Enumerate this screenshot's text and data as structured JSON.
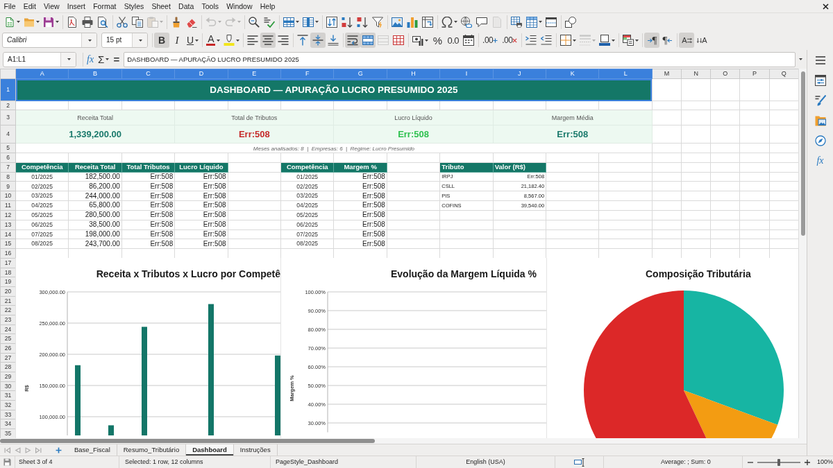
{
  "menu_bar": [
    "File",
    "Edit",
    "View",
    "Insert",
    "Format",
    "Styles",
    "Sheet",
    "Data",
    "Tools",
    "Window",
    "Help"
  ],
  "standard_toolbar": [
    [
      {
        "kind": "split",
        "disabled": false
      },
      {
        "kind": "split",
        "disabled": false
      },
      {
        "kind": "split",
        "disabled": false
      }
    ],
    [
      {
        "kind": "button",
        "disabled": false
      },
      {
        "kind": "button",
        "disabled": false
      },
      {
        "kind": "button",
        "disabled": false
      }
    ],
    [
      {
        "kind": "button",
        "disabled": false
      },
      {
        "kind": "button",
        "disabled": false
      },
      {
        "kind": "split",
        "disabled": true
      }
    ],
    [
      {
        "kind": "button",
        "disabled": false
      },
      {
        "kind": "button",
        "disabled": false
      }
    ],
    [
      {
        "kind": "split",
        "disabled": true
      },
      {
        "kind": "split",
        "disabled": true
      }
    ],
    [
      {
        "kind": "button",
        "disabled": false
      },
      {
        "kind": "button",
        "disabled": false
      }
    ],
    [
      {
        "kind": "split",
        "disabled": false
      },
      {
        "kind": "split",
        "disabled": false
      }
    ],
    [
      {
        "kind": "button",
        "disabled": false
      },
      {
        "kind": "button",
        "disabled": false
      },
      {
        "kind": "button",
        "disabled": false
      },
      {
        "kind": "button",
        "disabled": false
      }
    ],
    [
      {
        "kind": "button",
        "disabled": false
      },
      {
        "kind": "button",
        "disabled": false
      },
      {
        "kind": "button",
        "disabled": false
      }
    ],
    [
      {
        "kind": "split",
        "disabled": false
      },
      {
        "kind": "button",
        "disabled": false
      },
      {
        "kind": "button",
        "disabled": false
      },
      {
        "kind": "button",
        "disabled": true
      }
    ],
    [
      {
        "kind": "button",
        "disabled": false
      },
      {
        "kind": "split",
        "disabled": false
      },
      {
        "kind": "button",
        "disabled": false
      }
    ],
    [
      {
        "kind": "button",
        "disabled": false
      }
    ]
  ],
  "formatting_toolbar": {
    "font_name": "Calibri",
    "font_size": "15 pt",
    "groups": [
      [
        {
          "kind": "button",
          "label": "B",
          "pressed": true,
          "disabled": false
        },
        {
          "kind": "button",
          "label": "I",
          "pressed": false,
          "disabled": false
        },
        {
          "kind": "split",
          "label": "U",
          "pressed": false,
          "disabled": false
        }
      ],
      [
        {
          "kind": "split",
          "label": "A",
          "pressed": false,
          "disabled": false
        },
        {
          "kind": "split",
          "pressed": false,
          "disabled": false
        }
      ],
      [
        {
          "kind": "button",
          "pressed": false,
          "disabled": false
        },
        {
          "kind": "button",
          "pressed": true,
          "disabled": false
        },
        {
          "kind": "button",
          "pressed": false,
          "disabled": false
        }
      ],
      [
        {
          "kind": "button",
          "pressed": false,
          "disabled": false
        },
        {
          "kind": "button",
          "pressed": true,
          "disabled": false
        },
        {
          "kind": "button",
          "pressed": false,
          "disabled": false
        }
      ],
      [
        {
          "kind": "button",
          "pressed": true,
          "disabled": false
        },
        {
          "kind": "button",
          "pressed": true,
          "disabled": false
        },
        {
          "kind": "button",
          "pressed": false,
          "disabled": true
        },
        {
          "kind": "button",
          "pressed": false,
          "disabled": false
        }
      ],
      [
        {
          "kind": "split",
          "pressed": false,
          "disabled": false
        },
        {
          "kind": "button",
          "label": "%",
          "pressed": false,
          "disabled": false
        },
        {
          "kind": "button",
          "label": "0.0",
          "pressed": false,
          "disabled": false
        },
        {
          "kind": "button",
          "pressed": false,
          "disabled": false
        }
      ],
      [
        {
          "kind": "button",
          "label": ".00",
          "pressed": false,
          "disabled": false
        },
        {
          "kind": "button",
          "label": ".00",
          "pressed": false,
          "disabled": false
        }
      ],
      [
        {
          "kind": "button",
          "pressed": false,
          "disabled": false
        },
        {
          "kind": "button",
          "pressed": false,
          "disabled": false
        }
      ],
      [
        {
          "kind": "split",
          "pressed": false,
          "disabled": false
        },
        {
          "kind": "split",
          "pressed": false,
          "disabled": true
        },
        {
          "kind": "split",
          "pressed": false,
          "disabled": false
        }
      ],
      [
        {
          "kind": "split",
          "pressed": false,
          "disabled": false
        }
      ],
      [
        {
          "kind": "button",
          "label": "¶",
          "pressed": true,
          "disabled": false
        },
        {
          "kind": "button",
          "label": "¶",
          "pressed": false,
          "disabled": false
        }
      ],
      [
        {
          "kind": "button",
          "label": "A",
          "pressed": true,
          "disabled": false
        },
        {
          "kind": "button",
          "label": "A",
          "pressed": false,
          "disabled": false
        }
      ]
    ]
  },
  "formula_bar": {
    "name_box": "A1:L1",
    "function_wizard": "fx",
    "sum": "Σ",
    "equals": "=",
    "formula": "DASHBOARD — APURAÇÃO LUCRO PRESUMIDO 2025"
  },
  "sidebar": [
    {
      "kind": "icon"
    },
    {
      "kind": "icon"
    },
    {
      "kind": "icon"
    },
    {
      "kind": "icon"
    },
    {
      "kind": "icon"
    },
    {
      "kind": "text",
      "label": "fx"
    }
  ],
  "sheet": {
    "columns": [
      {
        "label": "A",
        "selected": true
      },
      {
        "label": "B",
        "selected": true
      },
      {
        "label": "C",
        "selected": true
      },
      {
        "label": "D",
        "selected": true
      },
      {
        "label": "E",
        "selected": true
      },
      {
        "label": "F",
        "selected": true
      },
      {
        "label": "G",
        "selected": true
      },
      {
        "label": "H",
        "selected": true
      },
      {
        "label": "I",
        "selected": true
      },
      {
        "label": "J",
        "selected": true
      },
      {
        "label": "K",
        "selected": true
      },
      {
        "label": "L",
        "selected": true
      },
      {
        "label": "M",
        "selected": false
      },
      {
        "label": "N",
        "selected": false
      },
      {
        "label": "O",
        "selected": false
      },
      {
        "label": "P",
        "selected": false
      },
      {
        "label": "Q",
        "selected": false
      }
    ],
    "rows": [
      {
        "label": "1",
        "selected": true
      },
      {
        "label": "2",
        "selected": false
      },
      {
        "label": "3",
        "selected": false
      },
      {
        "label": "4",
        "selected": false
      },
      {
        "label": "5",
        "selected": false
      },
      {
        "label": "6",
        "selected": false
      },
      {
        "label": "7",
        "selected": false
      },
      {
        "label": "8",
        "selected": false
      },
      {
        "label": "9",
        "selected": false
      },
      {
        "label": "10",
        "selected": false
      },
      {
        "label": "11",
        "selected": false
      },
      {
        "label": "12",
        "selected": false
      },
      {
        "label": "13",
        "selected": false
      },
      {
        "label": "14",
        "selected": false
      },
      {
        "label": "15",
        "selected": false
      },
      {
        "label": "16",
        "selected": false
      },
      {
        "label": "17",
        "selected": false
      },
      {
        "label": "18",
        "selected": false
      },
      {
        "label": "19",
        "selected": false
      },
      {
        "label": "20",
        "selected": false
      },
      {
        "label": "21",
        "selected": false
      },
      {
        "label": "22",
        "selected": false
      },
      {
        "label": "23",
        "selected": false
      },
      {
        "label": "24",
        "selected": false
      },
      {
        "label": "25",
        "selected": false
      },
      {
        "label": "26",
        "selected": false
      },
      {
        "label": "27",
        "selected": false
      },
      {
        "label": "28",
        "selected": false
      },
      {
        "label": "29",
        "selected": false
      },
      {
        "label": "30",
        "selected": false
      },
      {
        "label": "31",
        "selected": false
      },
      {
        "label": "32",
        "selected": false
      },
      {
        "label": "33",
        "selected": false
      },
      {
        "label": "34",
        "selected": false
      },
      {
        "label": "35",
        "selected": false
      }
    ],
    "title": {
      "text": "DASHBOARD — APURAÇÃO LUCRO PRESUMIDO 2025",
      "selected": true
    },
    "kpis": [
      {
        "label": "Receita Total",
        "value": "1,339,200.00",
        "color": "#1b7a6c"
      },
      {
        "label": "Total de Tributos",
        "value": "Err:508",
        "color": "#c62b2b"
      },
      {
        "label": "Lucro Líquido",
        "value": "Err:508",
        "color": "#2fc150"
      },
      {
        "label": "Margem Média",
        "value": "Err:508",
        "color": "#1b7a6c"
      }
    ],
    "note": "Meses analisados: 8  |  Empresas: 6  |  Regime: Lucro Presumido",
    "tables": [
      {
        "columns": [
          "Competência",
          "Receita Total",
          "Total Tributos",
          "Lucro Líquido"
        ],
        "rows": [
          [
            "01/2025",
            "182,500.00",
            "Err:508",
            "Err:508"
          ],
          [
            "02/2025",
            "86,200.00",
            "Err:508",
            "Err:508"
          ],
          [
            "03/2025",
            "244,000.00",
            "Err:508",
            "Err:508"
          ],
          [
            "04/2025",
            "65,800.00",
            "Err:508",
            "Err:508"
          ],
          [
            "05/2025",
            "280,500.00",
            "Err:508",
            "Err:508"
          ],
          [
            "06/2025",
            "38,500.00",
            "Err:508",
            "Err:508"
          ],
          [
            "07/2025",
            "198,000.00",
            "Err:508",
            "Err:508"
          ],
          [
            "08/2025",
            "243,700.00",
            "Err:508",
            "Err:508"
          ]
        ]
      },
      {
        "columns": [
          "Competência",
          "Margem %"
        ],
        "rows": [
          [
            "01/2025",
            "Err:508"
          ],
          [
            "02/2025",
            "Err:508"
          ],
          [
            "03/2025",
            "Err:508"
          ],
          [
            "04/2025",
            "Err:508"
          ],
          [
            "05/2025",
            "Err:508"
          ],
          [
            "06/2025",
            "Err:508"
          ],
          [
            "07/2025",
            "Err:508"
          ],
          [
            "08/2025",
            "Err:508"
          ]
        ]
      },
      {
        "columns": [
          "Tributo",
          "Valor (R$)"
        ],
        "rows": [
          [
            "IRPJ",
            "Err:508"
          ],
          [
            "CSLL",
            "21,182.40"
          ],
          [
            "PIS",
            "8,567.00"
          ],
          [
            "COFINS",
            "39,540.00"
          ]
        ]
      }
    ],
    "charts": [
      {
        "chart_data": {
          "type": "bar",
          "title": "Receita x Tributos x Lucro por Competê",
          "ylabel": "R$",
          "categories": [
            null,
            null,
            null,
            null,
            null,
            null,
            null
          ],
          "ylim": [
            70000,
            300000
          ],
          "grid": true,
          "yticks": [
            {
              "value": 100000,
              "label": "100,000.00"
            },
            {
              "value": 150000,
              "label": "150,000.00"
            },
            {
              "value": 200000,
              "label": "200,000.00"
            },
            {
              "value": 250000,
              "label": "250,000.00"
            },
            {
              "value": 300000,
              "label": "300,000.00"
            }
          ],
          "series": [
            {
              "color": "#137668",
              "values": [
                182500,
                86200,
                244000,
                null,
                280500,
                null,
                198000
              ]
            }
          ]
        }
      },
      {
        "chart_data": {
          "type": "line",
          "title": "Evolução da Margem Líquida %",
          "ylabel": "Margem %",
          "categories": [
            null,
            null,
            null,
            null,
            null,
            null,
            null,
            null
          ],
          "ylim": [
            0.25,
            1.0
          ],
          "grid": true,
          "yticks": [
            {
              "value": 0.3,
              "label": "30.00%"
            },
            {
              "value": 0.4,
              "label": "40.00%"
            },
            {
              "value": 0.5,
              "label": "50.00%"
            },
            {
              "value": 0.6,
              "label": "60.00%"
            },
            {
              "value": 0.7,
              "label": "70.00%"
            },
            {
              "value": 0.8,
              "label": "80.00%"
            },
            {
              "value": 0.9,
              "label": "90.00%"
            },
            {
              "value": 1.0,
              "label": "100.00%"
            }
          ]
        }
      },
      {
        "chart_data": {
          "type": "pie",
          "title": "Composição Tributária",
          "values": [
            30.6,
            12.4,
            57.0
          ],
          "colors": [
            "#17b5a3",
            "#f39c12",
            "#dc2828"
          ]
        }
      }
    ]
  },
  "sheet_nav": [
    {
      "disabled": true
    },
    {
      "disabled": true
    },
    {
      "disabled": true
    },
    {
      "disabled": true
    }
  ],
  "sheet_tabs": [
    {
      "label": "Base_Fiscal",
      "selected": false
    },
    {
      "label": "Resumo_Tributário",
      "selected": false
    },
    {
      "label": "Dashboard",
      "selected": true
    },
    {
      "label": "Instruções",
      "selected": false
    }
  ],
  "status_bar": {
    "sheet": "Sheet 3 of 4",
    "selection": "Selected: 1 row, 12 columns",
    "page_style": "PageStyle_Dashboard",
    "language": "English (USA)",
    "summary": "Average: ; Sum: 0",
    "zoom": {
      "level": 0.5,
      "reading": "100%"
    }
  }
}
